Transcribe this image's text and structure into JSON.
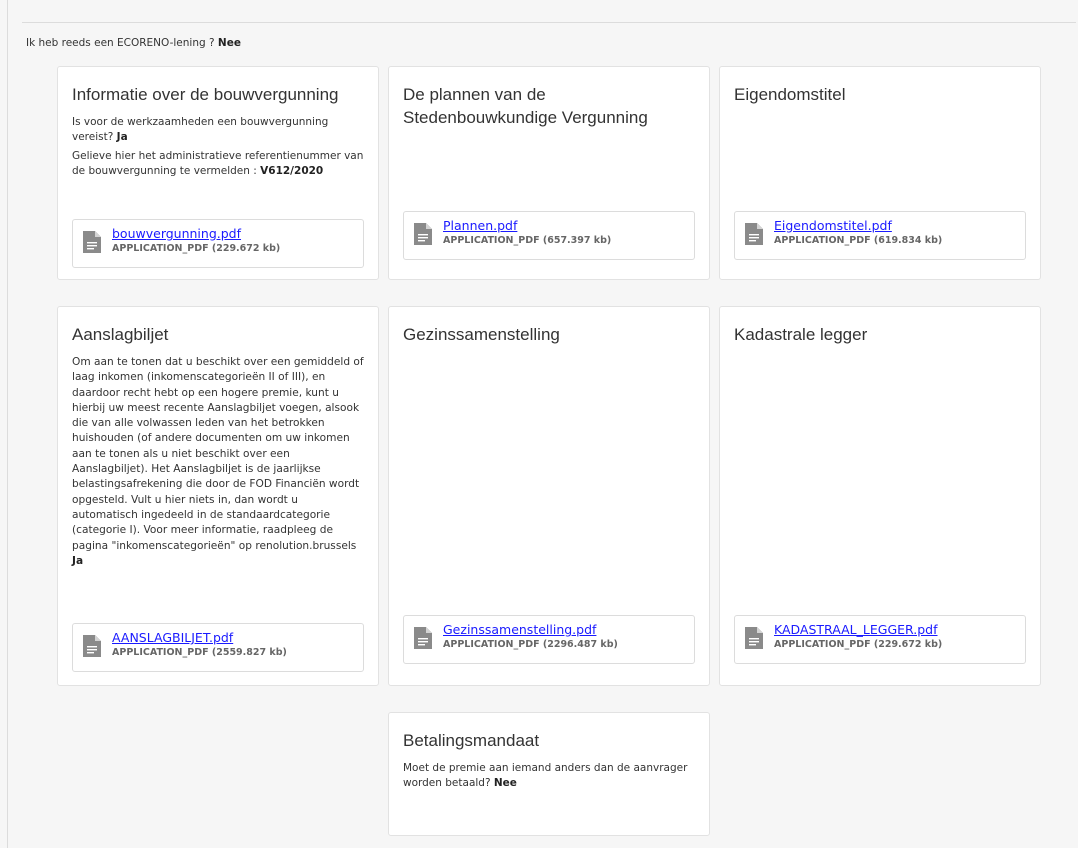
{
  "ecoreno": {
    "question": "Ik heb reeds een ECORENO-lening ?",
    "answer": "Nee"
  },
  "cards": {
    "bouwvergunning": {
      "title": "Informatie over de bouwvergunning",
      "q1": "Is voor de werkzaamheden een bouwvergunning vereist?",
      "a1": "Ja",
      "q2": "Gelieve hier het administratieve referentienummer van de bouwvergunning te vermelden :",
      "a2": "V612/2020",
      "file": {
        "name": "bouwvergunning.pdf",
        "meta": "APPLICATION_PDF (229.672 kb)"
      }
    },
    "plannen": {
      "title": "De plannen van de Stedenbouwkundige Vergunning",
      "file": {
        "name": "Plannen.pdf",
        "meta": "APPLICATION_PDF (657.397 kb)"
      }
    },
    "eigendomstitel": {
      "title": "Eigendomstitel",
      "file": {
        "name": "Eigendomstitel.pdf",
        "meta": "APPLICATION_PDF (619.834 kb)"
      }
    },
    "aanslagbiljet": {
      "title": "Aanslagbiljet",
      "text": "Om aan te tonen dat u beschikt over een gemiddeld of laag inkomen (inkomenscategorieën II of III), en daardoor recht hebt op een hogere premie, kunt u hierbij uw meest recente Aanslagbiljet voegen, alsook die van alle volwassen leden van het betrokken huishouden (of andere documenten om uw inkomen aan te tonen als u niet beschikt over een Aanslagbiljet). Het Aanslagbiljet is de jaarlijkse belastingsafrekening die door de FOD Financiën wordt opgesteld. Vult u hier niets in, dan wordt u automatisch ingedeeld in de standaardcategorie (categorie I). Voor meer informatie, raadpleeg de pagina \"inkomenscategorieën\" op renolution.brussels",
      "answer": "Ja",
      "file": {
        "name": "AANSLAGBILJET.pdf",
        "meta": "APPLICATION_PDF (2559.827 kb)"
      }
    },
    "gezinssamenstelling": {
      "title": "Gezinssamenstelling",
      "file": {
        "name": "Gezinssamenstelling.pdf",
        "meta": "APPLICATION_PDF (2296.487 kb)"
      }
    },
    "kadastrale": {
      "title": "Kadastrale legger",
      "file": {
        "name": "KADASTRAAL_LEGGER.pdf",
        "meta": "APPLICATION_PDF (229.672 kb)"
      }
    },
    "betalingsmandaat": {
      "title": "Betalingsmandaat",
      "q1": "Moet de premie aan iemand anders dan de aanvrager worden betaald?",
      "a1": "Nee"
    }
  },
  "icons": {
    "file": "file-document-icon"
  }
}
